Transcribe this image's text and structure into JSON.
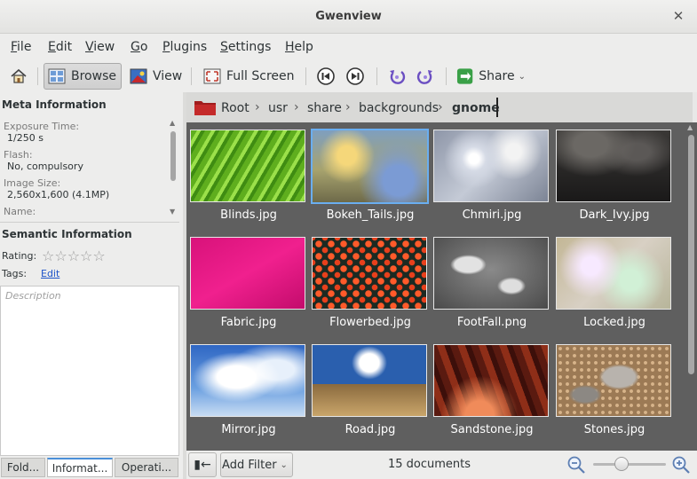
{
  "window": {
    "title": "Gwenview"
  },
  "menu": [
    {
      "u": "F",
      "rest": "ile"
    },
    {
      "u": "E",
      "rest": "dit"
    },
    {
      "u": "V",
      "rest": "iew"
    },
    {
      "u": "G",
      "rest": "o"
    },
    {
      "u": "P",
      "rest": "lugins"
    },
    {
      "u": "S",
      "rest": "ettings"
    },
    {
      "u": "H",
      "rest": "elp"
    }
  ],
  "toolbar": {
    "browse": "Browse",
    "view": "View",
    "fullscreen": "Full Screen",
    "share": "Share"
  },
  "meta": {
    "title": "Meta Information",
    "fields": [
      {
        "label": "Exposure Time:",
        "value": "1/250 s"
      },
      {
        "label": "Flash:",
        "value": "No, compulsory"
      },
      {
        "label": "Image Size:",
        "value": "2,560x1,600 (4.1MP)"
      },
      {
        "label": "Name:",
        "value": ""
      }
    ]
  },
  "semantic": {
    "title": "Semantic Information",
    "rating_label": "Rating:",
    "rating": 0,
    "tags_label": "Tags:",
    "tags_edit": "Edit",
    "description_placeholder": "Description"
  },
  "sidebar_tabs": [
    "Fold...",
    "Informat...",
    "Operati..."
  ],
  "breadcrumb": [
    "Root",
    "usr",
    "share",
    "backgrounds",
    "gnome"
  ],
  "thumbnails": [
    {
      "name": "Blinds.jpg"
    },
    {
      "name": "Bokeh_Tails.jpg",
      "selected": true
    },
    {
      "name": "Chmiri.jpg"
    },
    {
      "name": "Dark_Ivy.jpg"
    },
    {
      "name": "Fabric.jpg"
    },
    {
      "name": "Flowerbed.jpg"
    },
    {
      "name": "FootFall.png"
    },
    {
      "name": "Locked.jpg"
    },
    {
      "name": "Mirror.jpg"
    },
    {
      "name": "Road.jpg"
    },
    {
      "name": "Sandstone.jpg"
    },
    {
      "name": "Stones.jpg"
    }
  ],
  "status": {
    "add_filter": "Add Filter",
    "documents": "15 documents",
    "zoom_level": 0.35
  }
}
